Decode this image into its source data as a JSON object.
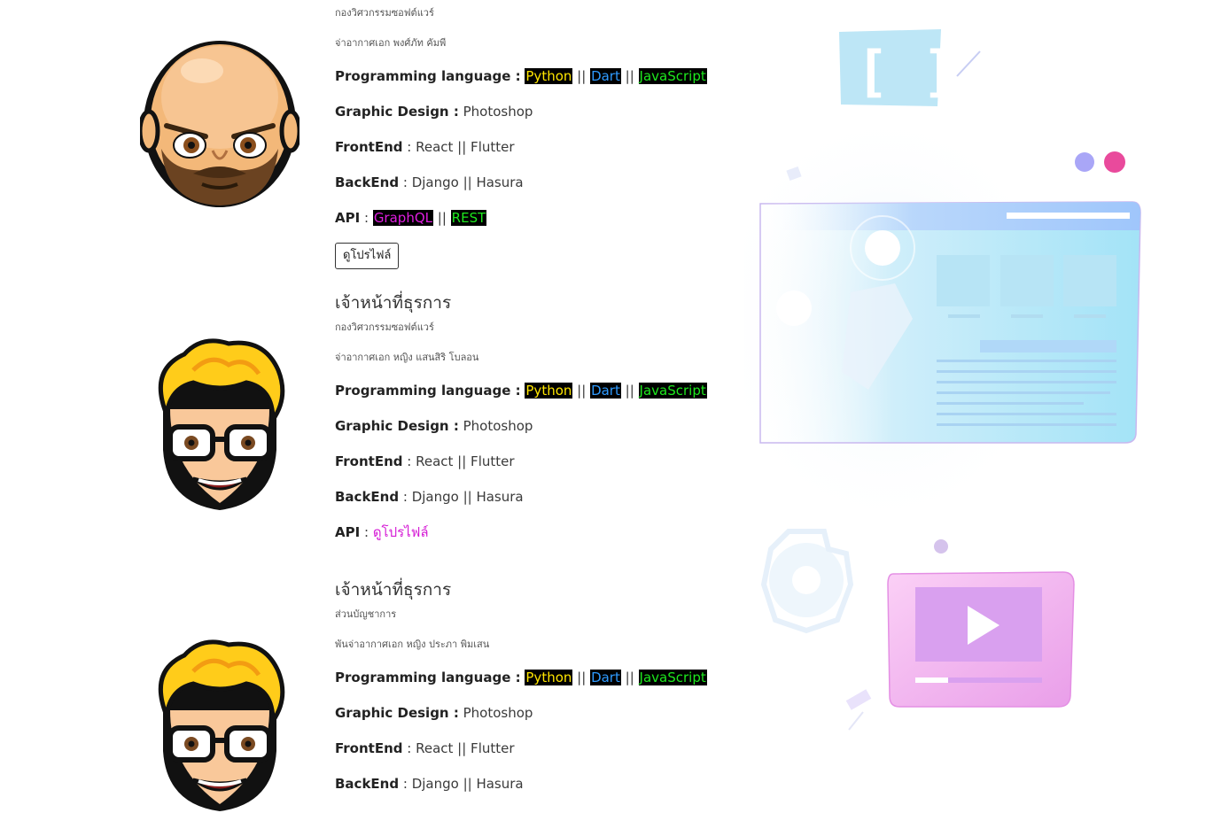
{
  "profiles": [
    {
      "dept": "กองวิศวกรรมซอฟต์แวร์",
      "name": "จ่าอากาศเอก พงศ์ภัท คัมพี",
      "prog_label": "Programming language :",
      "tags": [
        "Python",
        "Dart",
        "JavaScript"
      ],
      "sep": "||",
      "graphic_label": "Graphic Design :",
      "graphic_value": "Photoshop",
      "frontend_label": "FrontEnd",
      "frontend_value": ": React || Flutter",
      "backend_label": "BackEnd",
      "backend_value": ": Django || Hasura",
      "api_label": "API",
      "api_colon": ":",
      "api_tags": [
        "GraphQL",
        "REST"
      ],
      "button": "ดูโปรไฟล์"
    },
    {
      "role": "เจ้าหน้าที่ธุรการ",
      "dept": "กองวิศวกรรมซอฟต์แวร์",
      "name": "จ่าอากาศเอก หญิง แสนสิริ โบลอน",
      "prog_label": "Programming language :",
      "tags": [
        "Python",
        "Dart",
        "JavaScript"
      ],
      "sep": "||",
      "graphic_label": "Graphic Design :",
      "graphic_value": "Photoshop",
      "frontend_label": "FrontEnd",
      "frontend_value": ": React || Flutter",
      "backend_label": "BackEnd",
      "backend_value": ": Django || Hasura",
      "api_label": "API",
      "api_colon": ":",
      "api_link": "ดูโปรไฟล์"
    },
    {
      "role": "เจ้าหน้าที่ธุรการ",
      "dept": "ส่วนบัญชาการ",
      "name": "พันจ่าอากาศเอก หญิง ประภา พิมเสน",
      "prog_label": "Programming language :",
      "tags": [
        "Python",
        "Dart",
        "JavaScript"
      ],
      "sep": "||",
      "graphic_label": "Graphic Design :",
      "graphic_value": "Photoshop",
      "frontend_label": "FrontEnd",
      "frontend_value": ": React || Flutter",
      "backend_label": "BackEnd",
      "backend_value": ": Django || Hasura"
    }
  ],
  "colors": {
    "python": "#ffe600",
    "dart": "#2f9bff",
    "javascript": "#1ee81e",
    "graphql": "#e01ee0",
    "link": "#d51bd5"
  },
  "illustration": {
    "bracket_icon": "[ ]",
    "icons": [
      "code-bracket-icon",
      "browser-window-icon",
      "gear-icon",
      "video-play-icon"
    ]
  }
}
